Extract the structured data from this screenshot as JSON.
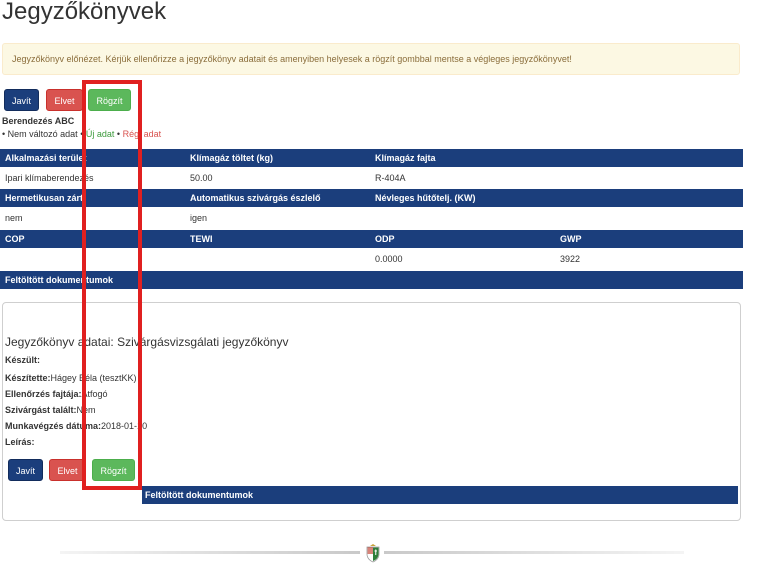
{
  "page_title": "Jegyzőkönyvek",
  "alert_text": "Jegyzőkönyv előnézet. Kérjük ellenőrizze a jegyzőkönyv adatait és amenyiben helyesek a rögzít gombbal mentse a végleges jegyzőkönyvet!",
  "buttons": {
    "edit": "Javít",
    "reject": "Elvet",
    "save": "Rögzít"
  },
  "equipment_name": "Berendezés ABC",
  "legend": {
    "prefix": "• Nem változó adat •",
    "new": "Új adat",
    "sep": "•",
    "old": "Régi adat"
  },
  "equipment_table": {
    "row1_headers": [
      "Alkalmazási terület",
      "Klímagáz töltet (kg)",
      "Klímagáz fajta"
    ],
    "row1_values": [
      "Ipari klímaberendezés",
      "50.00",
      "R-404A"
    ],
    "row2_headers": [
      "Hermetikusan zárt",
      "Automatikus szivárgás észlelő",
      "Névleges hűtőtelj. (KW)"
    ],
    "row2_values": [
      "nem",
      "igen",
      ""
    ],
    "row3_headers": [
      "COP",
      "TEWI",
      "ODP",
      "GWP"
    ],
    "row3_values": [
      "",
      "",
      "0.0000",
      "3922"
    ],
    "docs_header": "Feltöltött dokumentumok"
  },
  "protocol": {
    "title": "Jegyzőkönyv adatai: Szivárgásvizsgálati jegyzőkönyv",
    "fields": [
      {
        "label": "Készült:",
        "value": ""
      },
      {
        "label": "Készítette:",
        "value": "Hágey Béla (tesztKK)"
      },
      {
        "label": "Ellenőrzés fajtája:",
        "value": "Átfogó"
      },
      {
        "label": "Szivárgást talált:",
        "value": "Nem"
      },
      {
        "label": "Munkavégzés dátuma:",
        "value": "2018-01-10"
      },
      {
        "label": "Leírás:",
        "value": ""
      }
    ],
    "docs_header": "Feltöltött dokumentumok"
  },
  "colors": {
    "primary": "#1b3e7c",
    "danger": "#d9534f",
    "success": "#5cb85c",
    "highlight": "#e02020"
  }
}
